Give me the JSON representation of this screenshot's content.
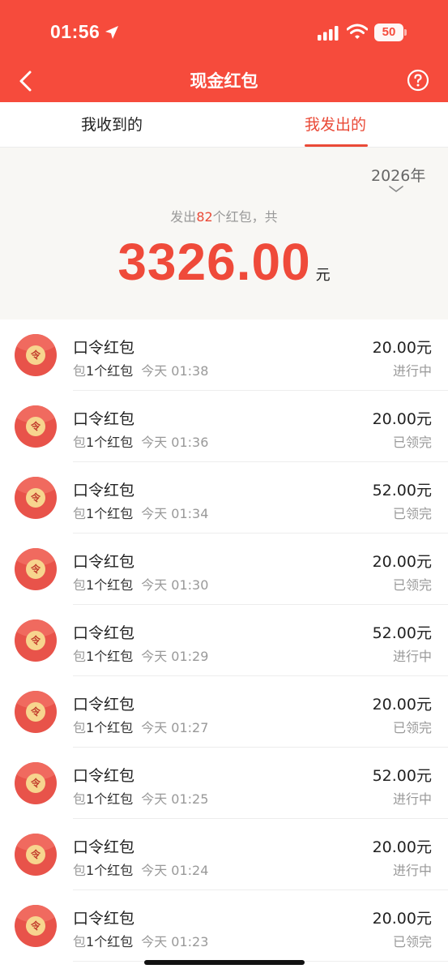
{
  "status_bar": {
    "time": "01:56",
    "battery": "50"
  },
  "nav": {
    "title": "现金红包"
  },
  "tabs": [
    {
      "label": "我收到的",
      "active": false
    },
    {
      "label": "我发出的",
      "active": true
    }
  ],
  "summary": {
    "year": "2026年",
    "prefix": "发出",
    "count": "82",
    "suffix": "个红包，共",
    "amount": "3326.00",
    "unit": "元"
  },
  "list": {
    "items": [
      {
        "icon_char": "令",
        "title": "口令红包",
        "prefix": "包",
        "count": "1个红包",
        "time": "今天 01:38",
        "amount": "20.00元",
        "status": "进行中"
      },
      {
        "icon_char": "令",
        "title": "口令红包",
        "prefix": "包",
        "count": "1个红包",
        "time": "今天 01:36",
        "amount": "20.00元",
        "status": "已领完"
      },
      {
        "icon_char": "令",
        "title": "口令红包",
        "prefix": "包",
        "count": "1个红包",
        "time": "今天 01:34",
        "amount": "52.00元",
        "status": "已领完"
      },
      {
        "icon_char": "令",
        "title": "口令红包",
        "prefix": "包",
        "count": "1个红包",
        "time": "今天 01:30",
        "amount": "20.00元",
        "status": "已领完"
      },
      {
        "icon_char": "令",
        "title": "口令红包",
        "prefix": "包",
        "count": "1个红包",
        "time": "今天 01:29",
        "amount": "52.00元",
        "status": "进行中"
      },
      {
        "icon_char": "令",
        "title": "口令红包",
        "prefix": "包",
        "count": "1个红包",
        "time": "今天 01:27",
        "amount": "20.00元",
        "status": "已领完"
      },
      {
        "icon_char": "令",
        "title": "口令红包",
        "prefix": "包",
        "count": "1个红包",
        "time": "今天 01:25",
        "amount": "52.00元",
        "status": "进行中"
      },
      {
        "icon_char": "令",
        "title": "口令红包",
        "prefix": "包",
        "count": "1个红包",
        "time": "今天 01:24",
        "amount": "20.00元",
        "status": "进行中"
      },
      {
        "icon_char": "令",
        "title": "口令红包",
        "prefix": "包",
        "count": "1个红包",
        "time": "今天 01:23",
        "amount": "20.00元",
        "status": "已领完"
      }
    ]
  },
  "colors": {
    "brand": "#f64b3c",
    "accent": "#ea4a37",
    "amount": "#ef4a3a",
    "summary_bg": "#f8f7f4"
  },
  "icons": [
    "location-arrow-icon",
    "signal-icon",
    "wifi-icon",
    "battery-icon",
    "back-arrow-icon",
    "help-icon",
    "chevron-down-icon",
    "red-envelope-icon"
  ]
}
